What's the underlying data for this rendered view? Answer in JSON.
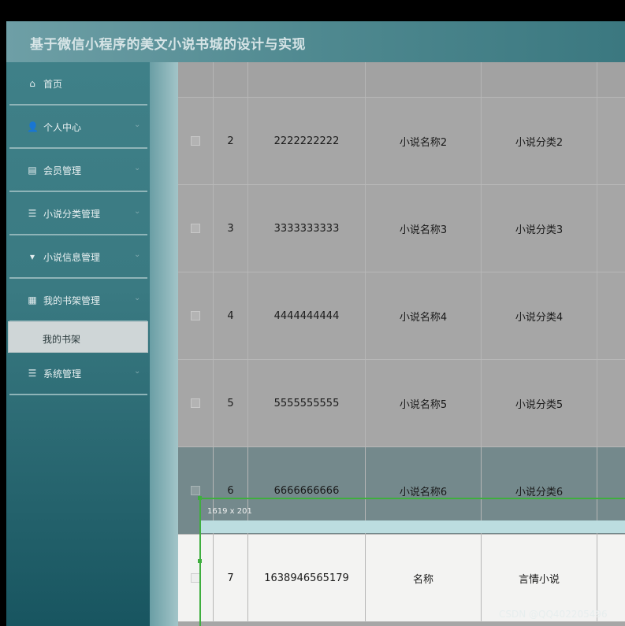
{
  "header": {
    "title": "基于微信小程序的美文小说书城的设计与实现"
  },
  "sidebar": {
    "items": [
      {
        "label": "首页",
        "icon": "home-icon",
        "glyph": "⌂",
        "chevron": ""
      },
      {
        "label": "个人中心",
        "icon": "user-icon",
        "glyph": "👤",
        "chevron": "⌄"
      },
      {
        "label": "会员管理",
        "icon": "clipboard-icon",
        "glyph": "▤",
        "chevron": "⌄"
      },
      {
        "label": "小说分类管理",
        "icon": "list-icon",
        "glyph": "☰",
        "chevron": "⌄"
      },
      {
        "label": "小说信息管理",
        "icon": "bookmark-icon",
        "glyph": "▾",
        "chevron": "⌄"
      },
      {
        "label": "我的书架管理",
        "icon": "grid-icon",
        "glyph": "▦",
        "chevron": "⌄"
      },
      {
        "label": "系统管理",
        "icon": "menu-icon",
        "glyph": "☰",
        "chevron": "⌄"
      }
    ],
    "submenu": {
      "label": "我的书架"
    }
  },
  "table": {
    "rows": [
      {
        "index": "2",
        "number": "2222222222",
        "name": "小说名称2",
        "category": "小说分类2"
      },
      {
        "index": "3",
        "number": "3333333333",
        "name": "小说名称3",
        "category": "小说分类3"
      },
      {
        "index": "4",
        "number": "4444444444",
        "name": "小说名称4",
        "category": "小说分类4"
      },
      {
        "index": "5",
        "number": "5555555555",
        "name": "小说名称5",
        "category": "小说分类5"
      },
      {
        "index": "6",
        "number": "6666666666",
        "name": "小说名称6",
        "category": "小说分类6"
      },
      {
        "index": "7",
        "number": "1638946565179",
        "name": "名称",
        "category": "言情小说"
      }
    ]
  },
  "overlay": {
    "size_label": "1619 x 201"
  },
  "watermark": {
    "text": "CSDN @QQ402205496"
  },
  "colors": {
    "accent": "#3fae3f",
    "sidebar": "#3a7a82",
    "highlight_row": "#74898c"
  }
}
